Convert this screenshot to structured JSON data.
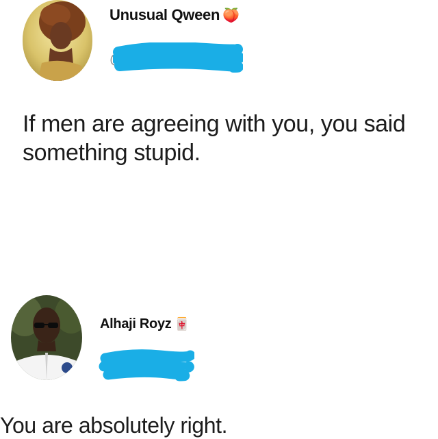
{
  "tweets": [
    {
      "display_name": "Unusual Qween",
      "name_emoji": "🍑",
      "handle_prefix": "@",
      "text": "If men are agreeing with you, you said something stupid.",
      "avatar_icon": "profile-photo-woman",
      "redaction_color": "#1aaee6"
    },
    {
      "display_name": "Alhaji Royz",
      "name_emoji": "🀄",
      "handle_prefix": "@",
      "text": "You are absolutely right.",
      "avatar_icon": "profile-photo-man-sunglasses",
      "redaction_color": "#1aaee6"
    }
  ]
}
